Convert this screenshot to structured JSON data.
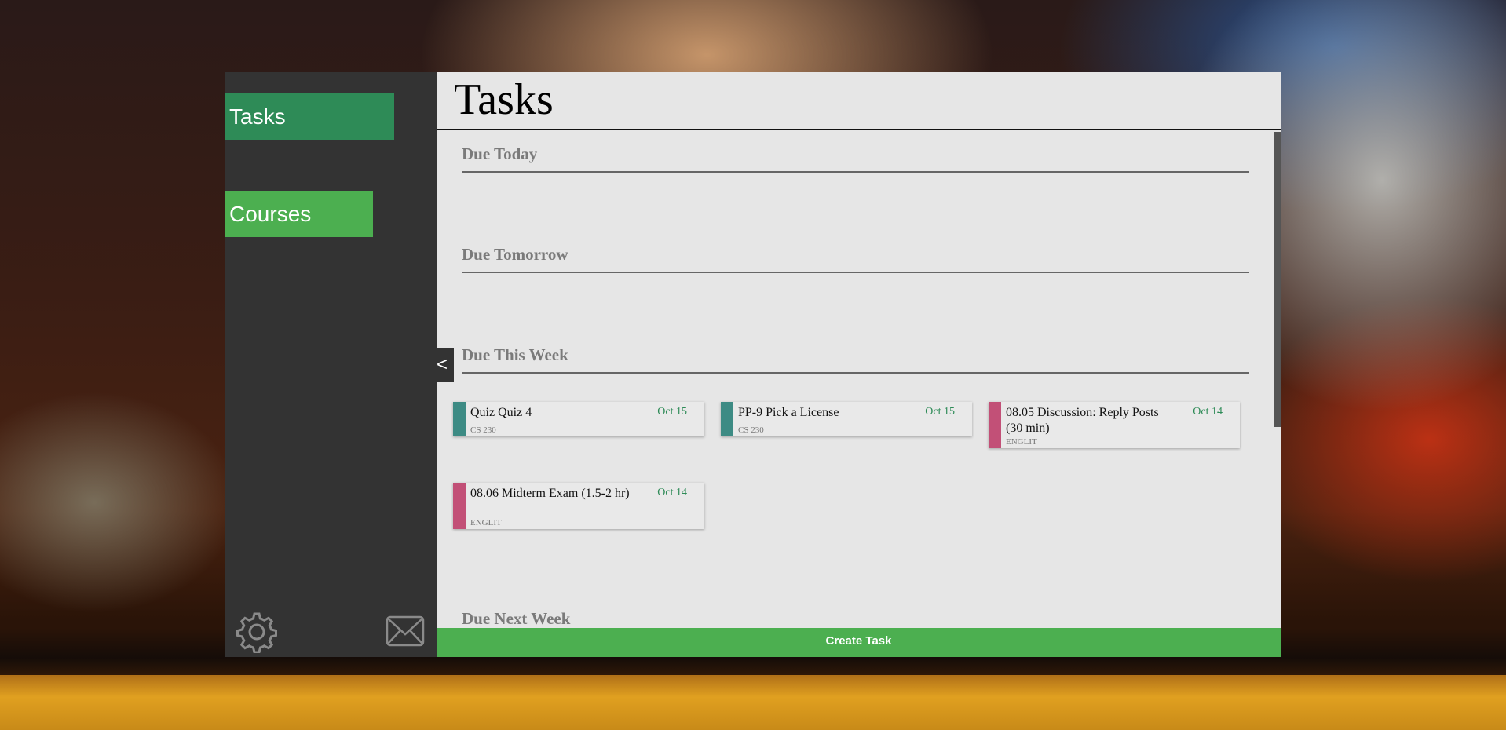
{
  "nav": {
    "tasks_label": "Tasks",
    "courses_label": "Courses"
  },
  "header": {
    "title": "Tasks"
  },
  "sidebar": {
    "collapse_label": "<"
  },
  "sections": {
    "today": "Due Today",
    "tomorrow": "Due Tomorrow",
    "this_week": "Due This Week",
    "next_week": "Due Next Week"
  },
  "tasks": [
    {
      "title": "Quiz Quiz 4",
      "date": "Oct 15",
      "course": "CS 230",
      "color": "#3d8b84"
    },
    {
      "title": "PP-9 Pick a License",
      "date": "Oct 15",
      "course": "CS 230",
      "color": "#3d8b84"
    },
    {
      "title": "08.05 Discussion: Reply Posts (30 min)",
      "date": "Oct 14",
      "course": "ENGLIT",
      "color": "#c25077"
    },
    {
      "title": "08.06 Midterm Exam (1.5-2 hr)",
      "date": "Oct 14",
      "course": "ENGLIT",
      "color": "#c25077"
    }
  ],
  "footer": {
    "create_label": "Create Task"
  },
  "colors": {
    "accent_dark": "#2e8b57",
    "accent": "#4caf50",
    "sidebar": "#333333",
    "panel": "#e6e6e6"
  },
  "icons": {
    "settings": "gear-icon",
    "mail": "mail-icon"
  }
}
